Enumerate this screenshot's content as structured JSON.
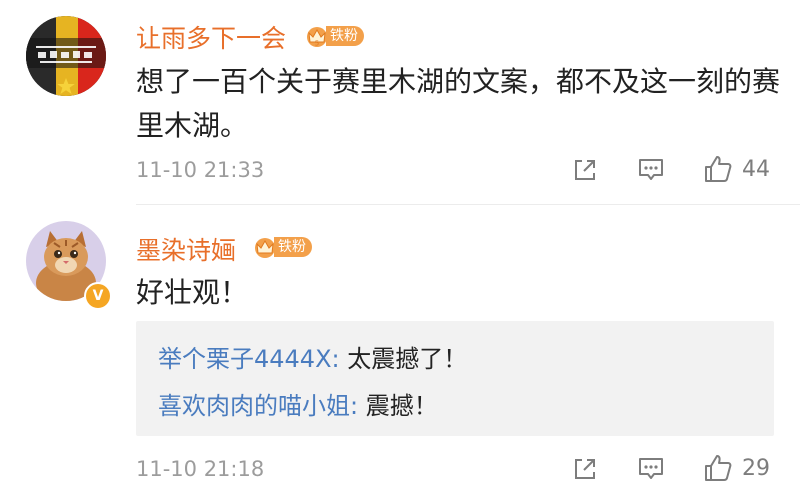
{
  "comments": [
    {
      "username": "让雨多下一会",
      "badge_level": "5",
      "badge_text": "铁粉",
      "text": "想了一百个关于赛里木湖的文案，都不及这一刻的赛里木湖。",
      "timestamp": "11-10 21:33",
      "likes": "44",
      "avatar_icon": "flag-calligraphy-avatar"
    },
    {
      "username": "墨染诗婳",
      "badge_level": "",
      "badge_text": "铁粉",
      "text": "好壮观！",
      "timestamp": "11-10 21:18",
      "likes": "29",
      "verified_mark": "V",
      "avatar_icon": "cat-avatar",
      "replies": [
        {
          "user": "举个栗子4444X",
          "separator": ": ",
          "text": "太震撼了！"
        },
        {
          "user": "喜欢肉肉的喵小姐",
          "separator": ": ",
          "text": "震撼！"
        }
      ]
    }
  ],
  "icons": {
    "share": "share-icon",
    "comment": "comment-icon",
    "like": "like-icon",
    "crown": "crown-icon"
  },
  "colors": {
    "username": "#e86f2a",
    "reply_user": "#4a7cbf",
    "badge": "#f3a04a",
    "timestamp": "#9c9c9c"
  }
}
